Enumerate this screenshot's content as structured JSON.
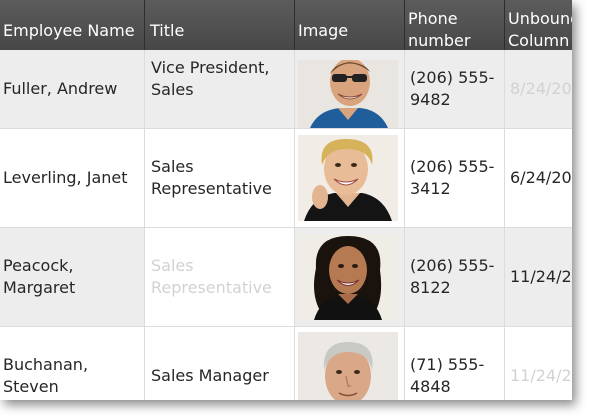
{
  "grid": {
    "columns": [
      "Employee Name",
      "Title",
      "Image",
      "Phone number",
      "Unbound Column"
    ],
    "rows": [
      {
        "name": "Fuller, Andrew",
        "title": "Vice President, Sales",
        "phone": "(206) 555-9482",
        "unbound": "8/24/20"
      },
      {
        "name": "Leverling, Janet",
        "title": "Sales Representative",
        "phone": "(206) 555-3412",
        "unbound": "6/24/20"
      },
      {
        "name": "Peacock, Margaret",
        "title": "Sales Representative",
        "phone": "(206) 555-8122",
        "unbound": "11/24/2"
      },
      {
        "name": "Buchanan, Steven",
        "title": "Sales Manager",
        "phone": "(71) 555-4848",
        "unbound": "11/24/2"
      }
    ]
  },
  "colors": {
    "header_bg": "#4a4a4a",
    "header_text": "#ffffff",
    "alt_row": "#ededed",
    "faded_text": "#d2d2d2"
  }
}
